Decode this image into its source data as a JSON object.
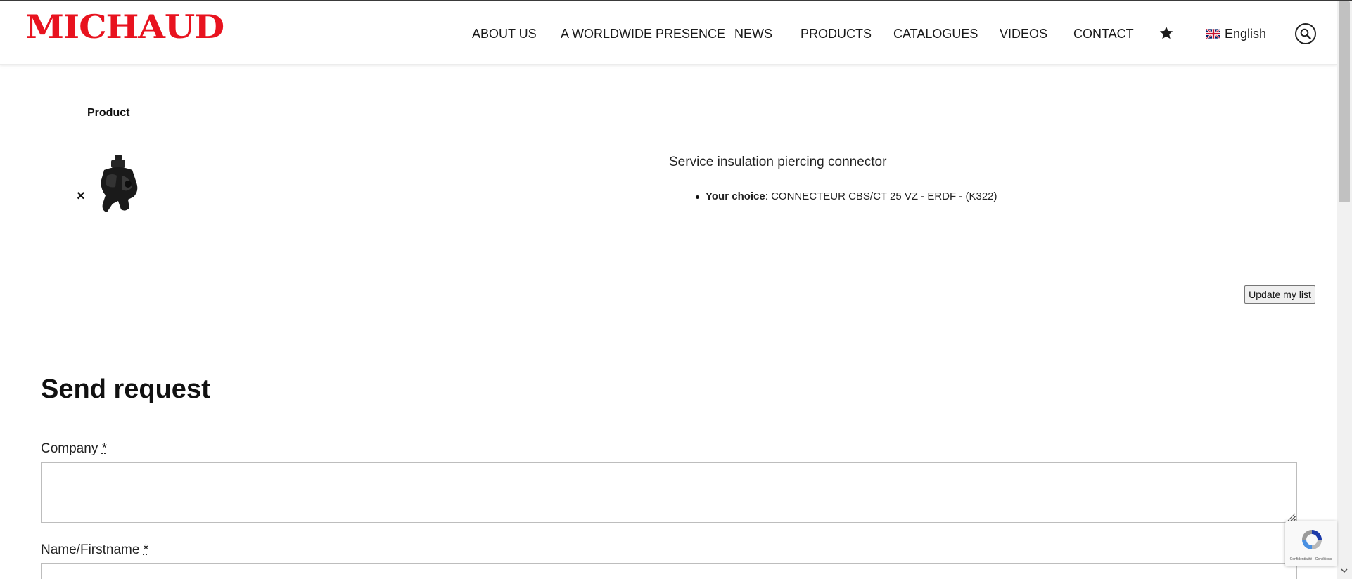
{
  "header": {
    "logo_text": "MICHAUD",
    "nav": [
      {
        "label": "ABOUT US"
      },
      {
        "label": "A WORLDWIDE PRESENCE"
      },
      {
        "label": "NEWS"
      },
      {
        "label": "PRODUCTS"
      },
      {
        "label": "CATALOGUES"
      },
      {
        "label": "VIDEOS"
      },
      {
        "label": "CONTACT"
      }
    ],
    "favorites_icon": "star-icon",
    "language": {
      "flag_icon": "uk-flag-icon",
      "label": "English"
    },
    "search_icon": "search-icon",
    "brand_color": "#e8131f"
  },
  "cart": {
    "column_header": "Product",
    "remove_symbol": "×",
    "items": [
      {
        "title": "Service insulation piercing connector",
        "choice_key": "Your choice",
        "choice_value": ": CONNECTEUR CBS/CT 25 VZ - ERDF - (K322)"
      }
    ],
    "update_button": "Update my list"
  },
  "form": {
    "heading": "Send request",
    "fields": [
      {
        "label": "Company",
        "required_mark": "*",
        "value": ""
      },
      {
        "label": "Name/Firstname",
        "required_mark": "*",
        "value": ""
      }
    ]
  },
  "recaptcha": {
    "links": "Confidentialité - Conditions"
  }
}
